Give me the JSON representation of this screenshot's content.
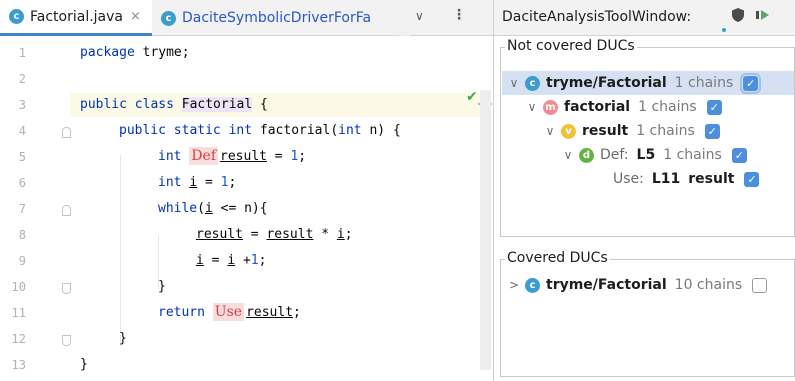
{
  "editor": {
    "tabs": [
      {
        "label": "Factorial.java",
        "icon": "class-icon",
        "active": true,
        "close": "×"
      },
      {
        "label": "DaciteSymbolicDriverForFa",
        "icon": "class-icon",
        "active": false
      }
    ],
    "tab_chevron": "∨",
    "tab_more": "⋮",
    "class_icon_letter": "c",
    "line_numbers": [
      "1",
      "2",
      "3",
      "4",
      "5",
      "6",
      "7",
      "8",
      "9",
      "10",
      "11",
      "12",
      "13"
    ],
    "inspection_status": "✔",
    "code": {
      "l1_kw": "package",
      "l1_rest": " tryme;",
      "l3_kw": "public class",
      "l3_sp": " ",
      "l3_name": "Factorial",
      "l3_rest": " {",
      "l4_kw": "public static int",
      "l4_rest": " factorial(",
      "l4_kw2": "int",
      "l4_rest2": " n) {",
      "l5_kw": "int",
      "l5_marker": "Def",
      "l5_var": "result",
      "l5_eq": " = ",
      "l5_num": "1",
      "l5_end": ";",
      "l6_kw": "int",
      "l6_var": "i",
      "l6_eq": " = ",
      "l6_num": "1",
      "l6_end": ";",
      "l7_kw": "while",
      "l7_p": "(",
      "l7_var": "i",
      "l7_rest": " <= n){",
      "l8_var1": "result",
      "l8_eq": " = ",
      "l8_var2": "result",
      "l8_op": " * ",
      "l8_var3": "i",
      "l8_end": ";",
      "l9_var1": "i",
      "l9_eq": " = ",
      "l9_var2": "i",
      "l9_op": " +",
      "l9_num": "1",
      "l9_end": ";",
      "l10": "}",
      "l11_kw": "return",
      "l11_marker": "Use",
      "l11_var": "result",
      "l11_end": ";",
      "l12": "}",
      "l13": "}"
    }
  },
  "tool_window": {
    "title": "DaciteAnalysisToolWindow:",
    "icons": [
      "shield-icon",
      "run-icon"
    ],
    "not_covered": {
      "title": "Not covered DUCs",
      "class_node": {
        "arrow": "∨",
        "icon_letter": "c",
        "name": "tryme/Factorial",
        "count": "1 chains",
        "checked": true
      },
      "method_node": {
        "arrow": "∨",
        "icon_letter": "m",
        "name": "factorial",
        "count": "1 chains",
        "checked": true
      },
      "var_node": {
        "arrow": "∨",
        "icon_letter": "v",
        "name": "result",
        "count": "1 chains",
        "checked": true
      },
      "def_node": {
        "arrow": "∨",
        "icon_letter": "d",
        "label": "Def:",
        "line": "L5",
        "count": "1 chains",
        "checked": true
      },
      "use_node": {
        "label": "Use:",
        "line": "L11",
        "var": "result",
        "checked": true
      }
    },
    "covered": {
      "title": "Covered DUCs",
      "class_node": {
        "arrow": ">",
        "icon_letter": "c",
        "name": "tryme/Factorial",
        "count": "10 chains",
        "checked": false
      }
    },
    "check_glyph": "✓"
  },
  "colors": {
    "accent": "#4083c9",
    "checkbox": "#4d8fdc",
    "keyword": "#0033b3",
    "number": "#1750eb",
    "marker_text": "#e03c3c",
    "marker_bg": "#f7dede",
    "selection": "#d5e1f2"
  }
}
